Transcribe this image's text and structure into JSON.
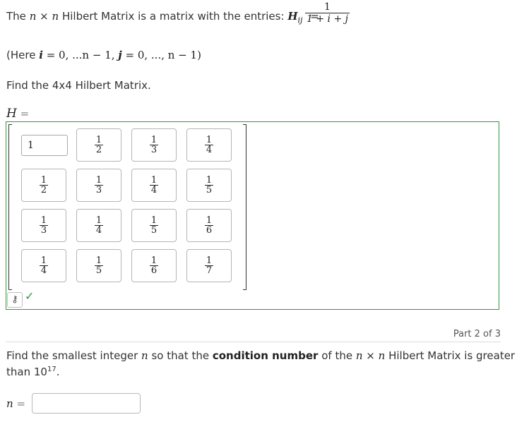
{
  "intro": {
    "before": "The",
    "n1": "n",
    "times": "×",
    "n2": "n",
    "after": "Hilbert Matrix is a matrix with the entries:",
    "entry_symbol": "H",
    "entry_sub": "ij",
    "equals": "=",
    "formula_numerator": "1",
    "formula_denominator": "1 + i + j"
  },
  "range_note": {
    "open": "(Here",
    "i": "i",
    "i_range": "= 0, ...n − 1,",
    "j": "j",
    "j_range": "= 0, ..., n − 1)"
  },
  "task": "Find the 4x4 Hilbert Matrix.",
  "matrix": {
    "label": "H",
    "equals": "=",
    "first_cell_value": "1",
    "cells": [
      [
        {
          "n": "",
          "d": ""
        },
        {
          "n": "1",
          "d": "2"
        },
        {
          "n": "1",
          "d": "3"
        },
        {
          "n": "1",
          "d": "4"
        }
      ],
      [
        {
          "n": "1",
          "d": "2"
        },
        {
          "n": "1",
          "d": "3"
        },
        {
          "n": "1",
          "d": "4"
        },
        {
          "n": "1",
          "d": "5"
        }
      ],
      [
        {
          "n": "1",
          "d": "3"
        },
        {
          "n": "1",
          "d": "4"
        },
        {
          "n": "1",
          "d": "5"
        },
        {
          "n": "1",
          "d": "6"
        }
      ],
      [
        {
          "n": "1",
          "d": "4"
        },
        {
          "n": "1",
          "d": "5"
        },
        {
          "n": "1",
          "d": "6"
        },
        {
          "n": "1",
          "d": "7"
        }
      ]
    ]
  },
  "icons": {
    "key": "key-icon",
    "check": "check-icon"
  },
  "colors": {
    "correct": "#2b9a3a",
    "text": "#333333"
  },
  "part": "Part 2 of 3",
  "question": {
    "before": "Find the smallest integer",
    "n": "n",
    "mid": "so that the",
    "bold": "condition number",
    "after1": "of the",
    "n2": "n",
    "times": "×",
    "n3": "n",
    "after2": "Hilbert Matrix is greater",
    "line2_before": "than 10",
    "exponent": "17",
    "line2_after": "."
  },
  "answer": {
    "label": "n",
    "equals": "=",
    "value": ""
  }
}
